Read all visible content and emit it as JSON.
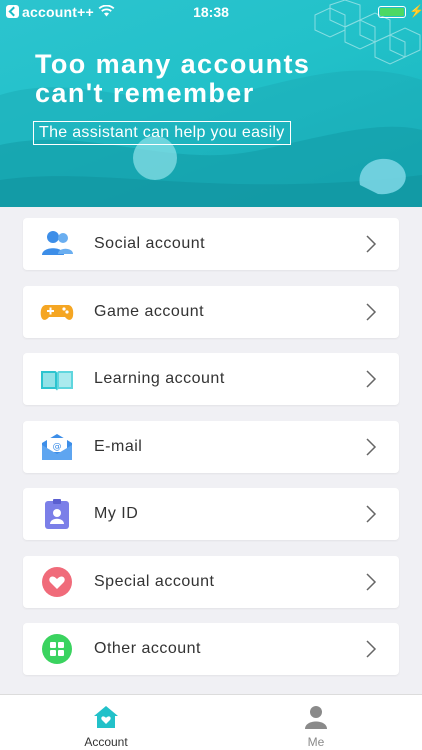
{
  "status_bar": {
    "app_name": "account++",
    "time": "18:38"
  },
  "hero": {
    "headline_line1": "Too many accounts",
    "headline_line2": "can't remember",
    "tagline": "The assistant can help you easily"
  },
  "categories": [
    {
      "label": "Social account",
      "icon": "people-icon",
      "color": "#3d8ee8"
    },
    {
      "label": "Game account",
      "icon": "gamepad-icon",
      "color": "#f5a623"
    },
    {
      "label": "Learning account",
      "icon": "book-icon",
      "color": "#2cc4cf"
    },
    {
      "label": "E-mail",
      "icon": "envelope-icon",
      "color": "#3d8ee8"
    },
    {
      "label": "My ID",
      "icon": "id-badge-icon",
      "color": "#7b7fe8"
    },
    {
      "label": "Special account",
      "icon": "heart-icon",
      "color": "#f06b7a"
    },
    {
      "label": "Other account",
      "icon": "grid-icon",
      "color": "#3ad35f"
    }
  ],
  "tabbar": {
    "tabs": [
      {
        "label": "Account",
        "icon": "home-heart-icon",
        "active": true,
        "color": "#22c1c9"
      },
      {
        "label": "Me",
        "icon": "person-icon",
        "active": false,
        "color": "#8a8a8a"
      }
    ]
  }
}
